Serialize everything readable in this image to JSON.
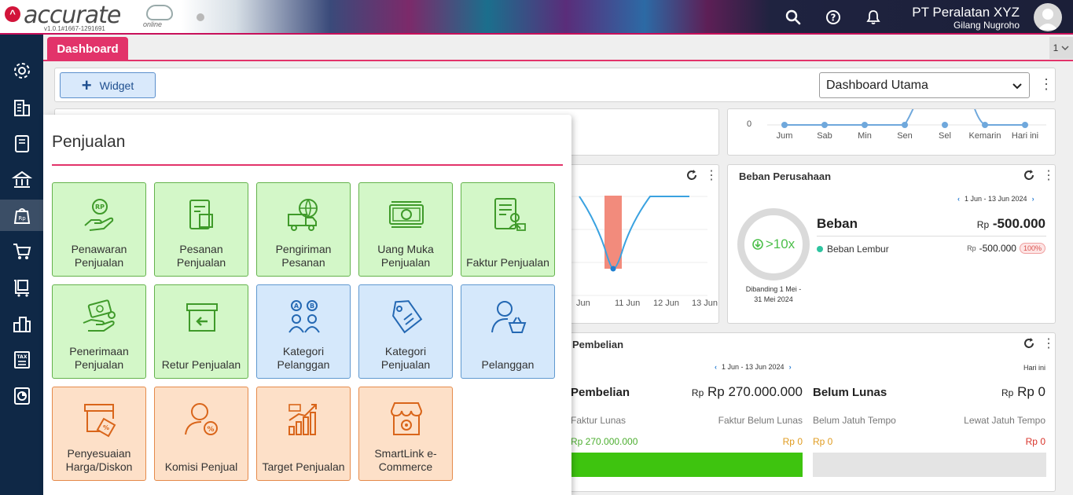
{
  "app": {
    "logo_text": "accurate",
    "logo_suffix": "online",
    "version": "v1.0.1#1667-1291691",
    "company": "PT Peralatan XYZ",
    "user": "Gilang Nugroho"
  },
  "tabs": {
    "active": "Dashboard",
    "count": "1"
  },
  "toolbar": {
    "widget_label": "Widget",
    "dashboard_select": "Dashboard Utama"
  },
  "weekly_chart": {
    "zero_label": "0",
    "days": [
      "Jum",
      "Sab",
      "Min",
      "Sen",
      "Sel",
      "Kemarin",
      "Hari ini"
    ]
  },
  "mid_chart": {
    "dates": [
      "Jun",
      "11 Jun",
      "12 Jun",
      "13 Jun"
    ]
  },
  "beban": {
    "title": "Beban Perusahaan",
    "range": "1 Jun - 13 Jun 2024",
    "ratio": ">10x",
    "compare_line1": "Dibanding 1 Mei -",
    "compare_line2": "31 Mei 2024",
    "heading": "Beban",
    "currency": "Rp",
    "total": "-500.000",
    "item_name": "Beban Lembur",
    "item_currency": "Rp",
    "item_value": "-500.000",
    "item_pct": "100%",
    "dot_color": "#2ec4a0"
  },
  "pembelian": {
    "title": "Pembelian",
    "range": "1 Jun - 13 Jun 2024",
    "today": "Hari ini",
    "heading": "Pembelian",
    "currency": "Rp",
    "total": "Rp 270.000.000",
    "belum_lunas": "Belum Lunas",
    "belum_currency": "Rp",
    "belum_total": "Rp 0",
    "faktur_lunas": "Faktur Lunas",
    "faktur_belum_lunas": "Faktur Belum Lunas",
    "belum_jatuh_tempo": "Belum Jatuh Tempo",
    "lewat_jatuh_tempo": "Lewat Jatuh Tempo",
    "lunas_value": "Rp 270.000.000",
    "belum_lunas_value": "Rp 0",
    "bjt_value": "Rp 0",
    "ljt_value": "Rp 0",
    "lunas_fill": 1.0
  },
  "panel": {
    "title": "Penjualan",
    "tiles": [
      {
        "label": "Penawaran Penjualan",
        "color": "green",
        "icon": "hand-coin-icon"
      },
      {
        "label": "Pesanan Penjualan",
        "color": "green",
        "icon": "order-document-icon"
      },
      {
        "label": "Pengiriman Pesanan",
        "color": "green",
        "icon": "delivery-truck-icon"
      },
      {
        "label": "Uang Muka Penjualan",
        "color": "green",
        "icon": "cash-money-icon"
      },
      {
        "label": "Faktur Penjualan",
        "color": "green",
        "icon": "invoice-icon"
      },
      {
        "label": "Penerimaan Penjualan",
        "color": "green",
        "icon": "receive-payment-icon"
      },
      {
        "label": "Retur Penjualan",
        "color": "green",
        "icon": "return-box-icon"
      },
      {
        "label": "Kategori Pelanggan",
        "color": "blue",
        "icon": "customer-category-icon"
      },
      {
        "label": "Kategori Penjualan",
        "color": "blue",
        "icon": "price-tag-icon"
      },
      {
        "label": "Pelanggan",
        "color": "blue",
        "icon": "customer-basket-icon"
      },
      {
        "label": "Penyesuaian Harga/Diskon",
        "color": "orange",
        "icon": "discount-box-icon"
      },
      {
        "label": "Komisi Penjual",
        "color": "orange",
        "icon": "commission-person-icon"
      },
      {
        "label": "Target Penjualan",
        "color": "orange",
        "icon": "sales-target-icon"
      },
      {
        "label": "SmartLink e-Commerce",
        "color": "orange",
        "icon": "ecommerce-store-icon"
      }
    ]
  }
}
